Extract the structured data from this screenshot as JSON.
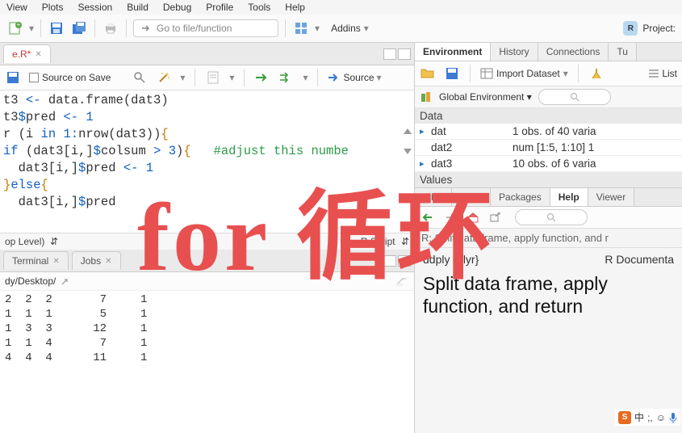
{
  "menu": [
    "View",
    "Plots",
    "Session",
    "Build",
    "Debug",
    "Profile",
    "Tools",
    "Help"
  ],
  "toolbar": {
    "goto_placeholder": "Go to file/function",
    "addins_label": "Addins",
    "project_label": "Project:"
  },
  "source": {
    "tab_name": "e.R*",
    "source_on_save": "Source on Save",
    "source_btn": "Source",
    "scope": "op Level)",
    "language": "R Script",
    "code_lines": [
      {
        "segments": [
          {
            "t": "t3 "
          },
          {
            "t": "<-",
            "c": "kw-blue"
          },
          {
            "t": " data.frame(dat3)"
          }
        ]
      },
      {
        "segments": [
          {
            "t": "t3"
          },
          {
            "t": "$",
            "c": "kw-blue"
          },
          {
            "t": "pred "
          },
          {
            "t": "<-",
            "c": "kw-blue"
          },
          {
            "t": " "
          },
          {
            "t": "1",
            "c": "num"
          }
        ]
      },
      {
        "segments": [
          {
            "t": "r ("
          },
          {
            "t": "i ",
            "c": ""
          },
          {
            "t": "in",
            "c": "kw-blue"
          },
          {
            "t": " "
          },
          {
            "t": "1",
            "c": "num"
          },
          {
            "t": ":",
            "c": "kw-blue"
          },
          {
            "t": "nrow(dat3))"
          },
          {
            "t": "{",
            "c": "brace"
          }
        ]
      },
      {
        "segments": [
          {
            "t": "if",
            "c": "kw-blue"
          },
          {
            "t": " (dat3[i,]"
          },
          {
            "t": "$",
            "c": "kw-blue"
          },
          {
            "t": "colsum "
          },
          {
            "t": ">",
            "c": "kw-blue"
          },
          {
            "t": " "
          },
          {
            "t": "3",
            "c": "num"
          },
          {
            "t": ")"
          },
          {
            "t": "{",
            "c": "brace"
          },
          {
            "t": "   "
          },
          {
            "t": "#adjust this numbe",
            "c": "cmt"
          }
        ]
      },
      {
        "segments": [
          {
            "t": "  dat3[i,]"
          },
          {
            "t": "$",
            "c": "kw-blue"
          },
          {
            "t": "pred "
          },
          {
            "t": "<-",
            "c": "kw-blue"
          },
          {
            "t": " "
          },
          {
            "t": "1",
            "c": "num"
          }
        ]
      },
      {
        "segments": [
          {
            "t": "}",
            "c": "brace"
          },
          {
            "t": "else",
            "c": "kw-blue"
          },
          {
            "t": "{",
            "c": "brace"
          }
        ]
      },
      {
        "segments": [
          {
            "t": "  dat3[i,]"
          },
          {
            "t": "$",
            "c": "kw-blue"
          },
          {
            "t": "pred "
          },
          {
            "t": "  "
          }
        ]
      },
      {
        "segments": [
          {
            "t": ""
          }
        ]
      }
    ]
  },
  "console": {
    "tabs": [
      "Terminal",
      "Jobs"
    ],
    "path": "dy/Desktop/",
    "output": "2  2  2       7     1\n1  1  1       5     1\n1  3  3      12     1\n1  1  4       7     1\n4  4  4      11     1"
  },
  "env": {
    "tabs": [
      "Environment",
      "History",
      "Connections",
      "Tu"
    ],
    "import_label": "Import Dataset",
    "list_label": "List",
    "scope": "Global Environment",
    "section": "Data",
    "values_section": "Values",
    "rows": [
      {
        "name": "dat",
        "desc": "1 obs. of 40 varia",
        "exp": true
      },
      {
        "name": "dat2",
        "desc": "num [1:5, 1:10] 1 ",
        "exp": false
      },
      {
        "name": "dat3",
        "desc": "10 obs. of 6 varia",
        "exp": true
      }
    ]
  },
  "help_pane": {
    "tabs": [
      "Files",
      "Plots",
      "Packages",
      "Help",
      "Viewer"
    ],
    "header": "R: Split data frame, apply function, and r",
    "fn": "ddply {plyr}",
    "doc_label": "R Documenta",
    "title": "Split data frame, apply function, and return"
  },
  "annotation_text": "for 循环",
  "status_tray": {
    "ime": "中",
    "punct": ";,",
    "smile": "☺"
  }
}
